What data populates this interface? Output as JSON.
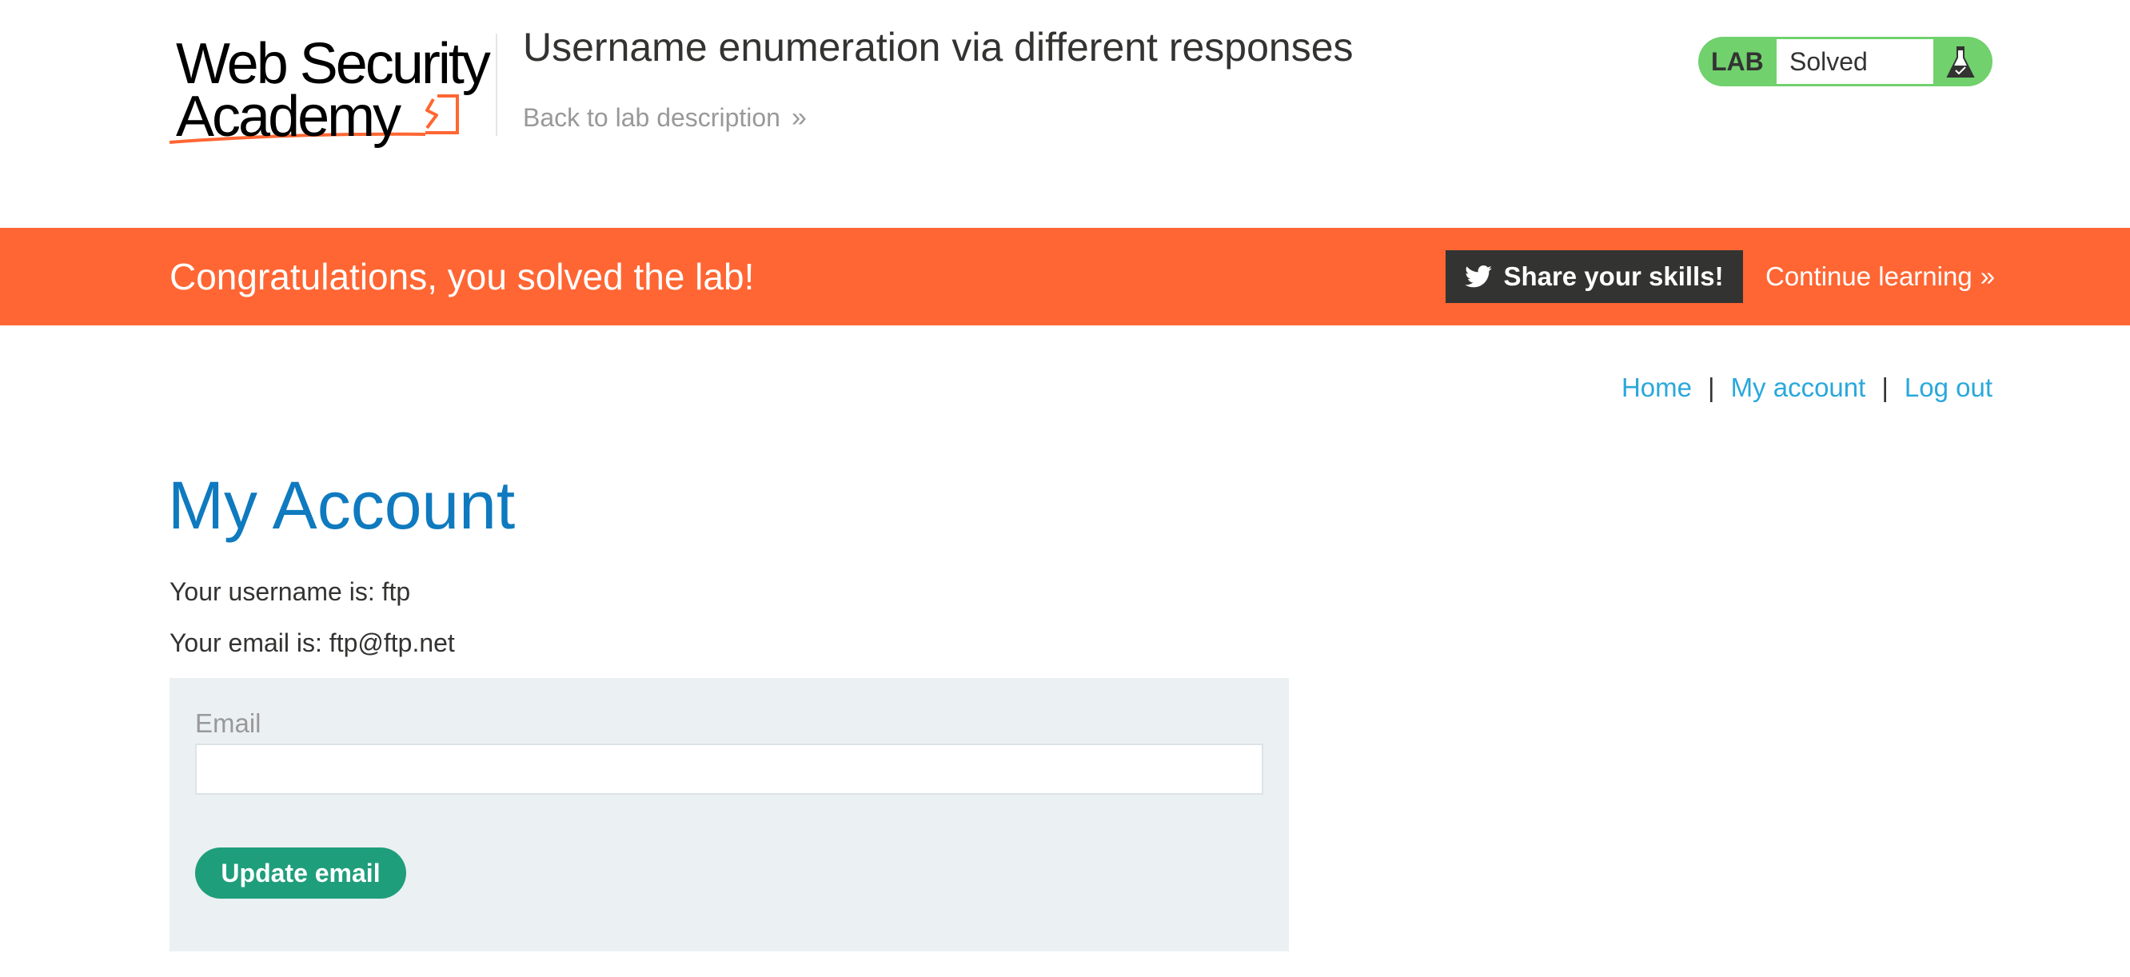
{
  "lab_header": {
    "logo": {
      "line1": "Web Security",
      "line2": "Academy"
    },
    "title": "Username enumeration via different responses",
    "back_link": "Back to lab description",
    "back_chevron": "»",
    "status": {
      "tag": "LAB",
      "value": "Solved",
      "icon": "flask-icon"
    }
  },
  "banner": {
    "message": "Congratulations, you solved the lab!",
    "share_label": "Share your skills!",
    "share_icon": "twitter-icon",
    "continue_label": "Continue learning",
    "continue_chevron": "»"
  },
  "nav": {
    "home": "Home",
    "my_account": "My account",
    "log_out": "Log out",
    "separator": "|"
  },
  "account": {
    "heading": "My Account",
    "username_line": "Your username is: ftp",
    "email_line": "Your email is: ftp@ftp.net",
    "form": {
      "email_label": "Email",
      "email_value": "",
      "submit_label": "Update email"
    }
  },
  "colors": {
    "banner": "#ff6633",
    "heading": "#0f7abf",
    "link": "#29a8dc",
    "status_green": "#70d16d",
    "button_green": "#1f9e7c",
    "panel_bg": "#ebf0f2"
  }
}
